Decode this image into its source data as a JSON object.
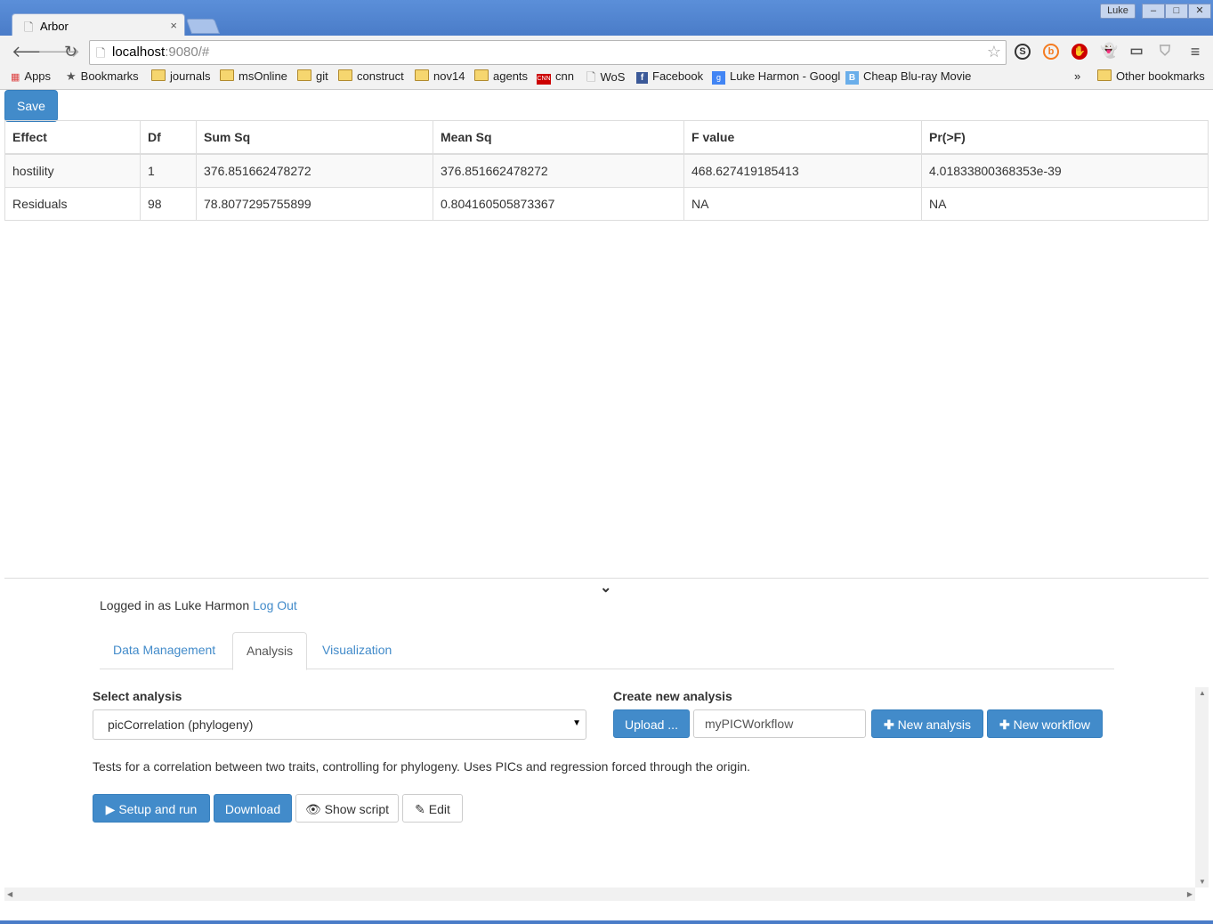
{
  "browser": {
    "tab_title": "Arbor",
    "tab_close": "×",
    "user_label": "Luke",
    "window_controls": [
      "–",
      "□",
      "✕"
    ],
    "url_host": "localhost",
    "url_rest": ":9080/#",
    "bookmarks": [
      {
        "label": "Apps",
        "icon": "apps-grid-icon"
      },
      {
        "label": "Bookmarks",
        "icon": "star-icon"
      },
      {
        "label": "journals",
        "icon": "folder-icon"
      },
      {
        "label": "msOnline",
        "icon": "folder-icon"
      },
      {
        "label": "git",
        "icon": "folder-icon"
      },
      {
        "label": "construct",
        "icon": "folder-icon"
      },
      {
        "label": "nov14",
        "icon": "folder-icon"
      },
      {
        "label": "agents",
        "icon": "folder-icon"
      },
      {
        "label": "cnn",
        "icon": "cnn-icon"
      },
      {
        "label": "WoS",
        "icon": "page-icon"
      },
      {
        "label": "Facebook",
        "icon": "facebook-icon"
      },
      {
        "label": "Luke Harmon - Googl",
        "icon": "scholar-icon"
      },
      {
        "label": "Cheap Blu-ray Movie",
        "icon": "b-icon"
      }
    ],
    "overflow": "»",
    "other_bookmarks": "Other bookmarks"
  },
  "app": {
    "save_label": "Save",
    "table": {
      "headers": [
        "Effect",
        "Df",
        "Sum Sq",
        "Mean Sq",
        "F value",
        "Pr(>F)"
      ],
      "rows": [
        [
          "hostility",
          "1",
          "376.851662478272",
          "376.851662478272",
          "468.627419185413",
          "4.01833800368353e-39"
        ],
        [
          "Residuals",
          "98",
          "78.8077295755899",
          "0.804160505873367",
          "NA",
          "NA"
        ]
      ]
    },
    "login": {
      "prefix": "Logged in as Luke Harmon",
      "logout": "Log Out"
    },
    "tabs": [
      "Data Management",
      "Analysis",
      "Visualization"
    ],
    "active_tab": "Analysis",
    "select_analysis": {
      "label": "Select analysis",
      "value": "picCorrelation (phylogeny)"
    },
    "create": {
      "label": "Create new analysis",
      "upload": "Upload ...",
      "name_value": "myPICWorkflow",
      "new_analysis": "New analysis",
      "new_workflow": "New workflow"
    },
    "description": "Tests for a correlation between two traits, controlling for phylogeny. Uses PICs and regression forced through the origin.",
    "actions": {
      "setup_run": "Setup and run",
      "download": "Download",
      "show_script": "Show script",
      "edit": "Edit"
    }
  },
  "colors": {
    "primary": "#428bca",
    "chrome": "#4a7cc8"
  }
}
